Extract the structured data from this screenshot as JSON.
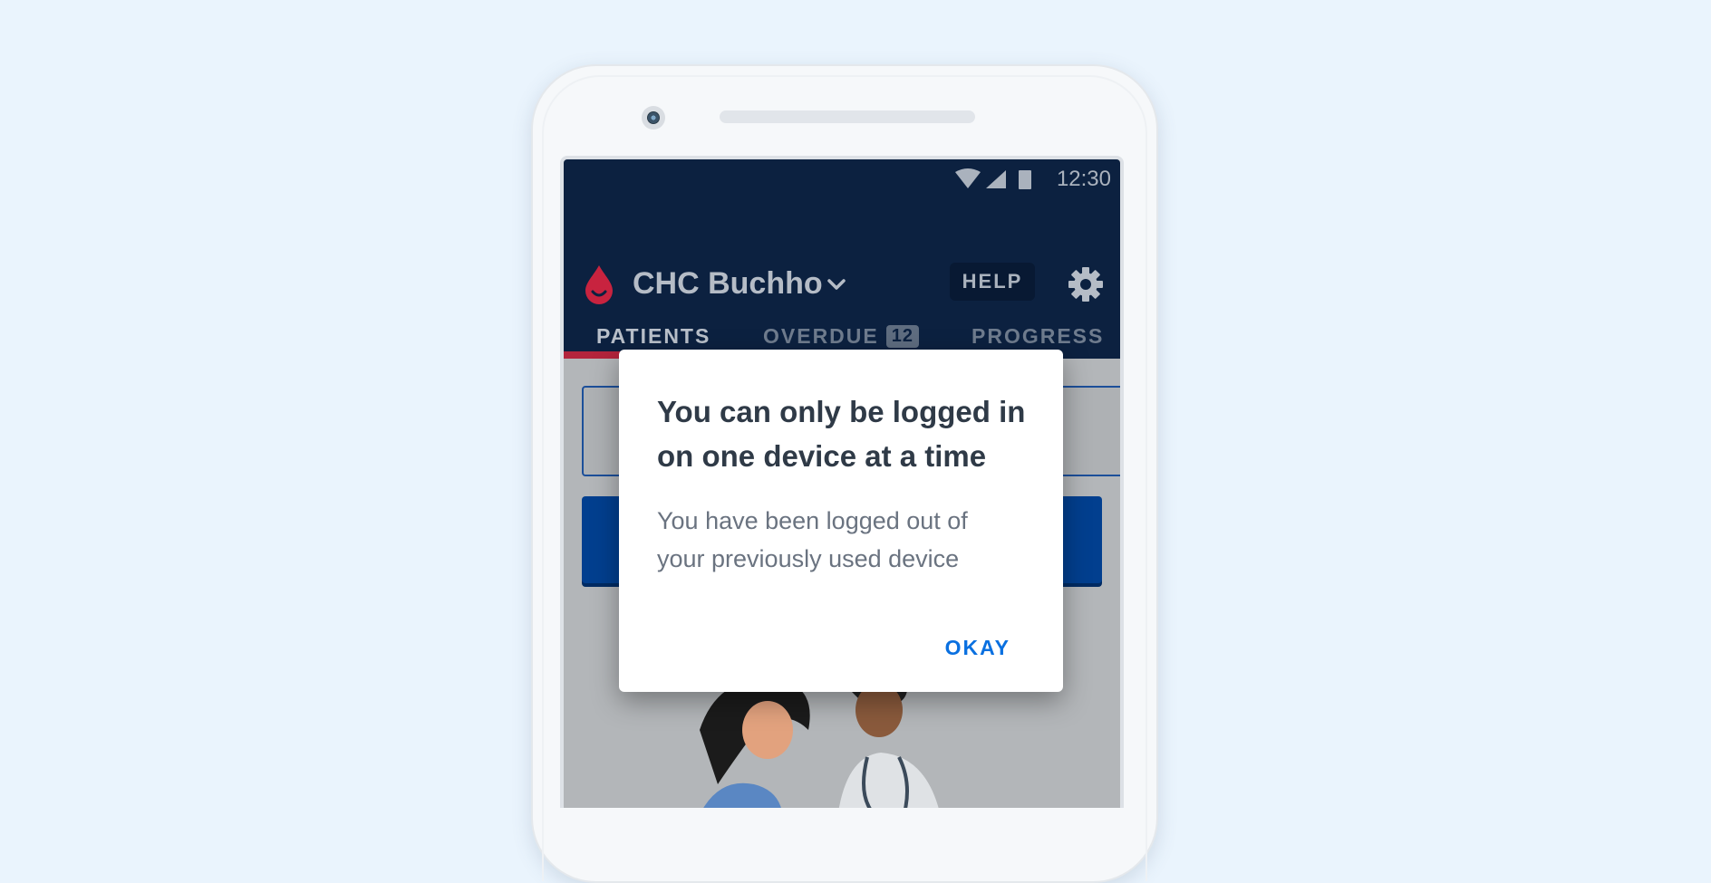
{
  "status_bar": {
    "time": "12:30",
    "icons": [
      "wifi-icon",
      "signal-icon",
      "battery-icon"
    ]
  },
  "app_bar": {
    "facility_name": "CHC Buchho",
    "help_label": "HELP",
    "tabs": [
      {
        "label": "PATIENTS",
        "active": true
      },
      {
        "label": "OVERDUE",
        "badge": "12",
        "active": false
      },
      {
        "label": "PROGRESS",
        "active": false
      }
    ]
  },
  "dialog": {
    "title": "You can only be logged in on one device at a time",
    "body": "You have been logged out of your previously used device",
    "okay_label": "OKAY"
  },
  "colors": {
    "background": "#eaf4fd",
    "app_bar": "#0c2140",
    "accent_red": "#b3243c",
    "primary_blue": "#0a70e0"
  }
}
